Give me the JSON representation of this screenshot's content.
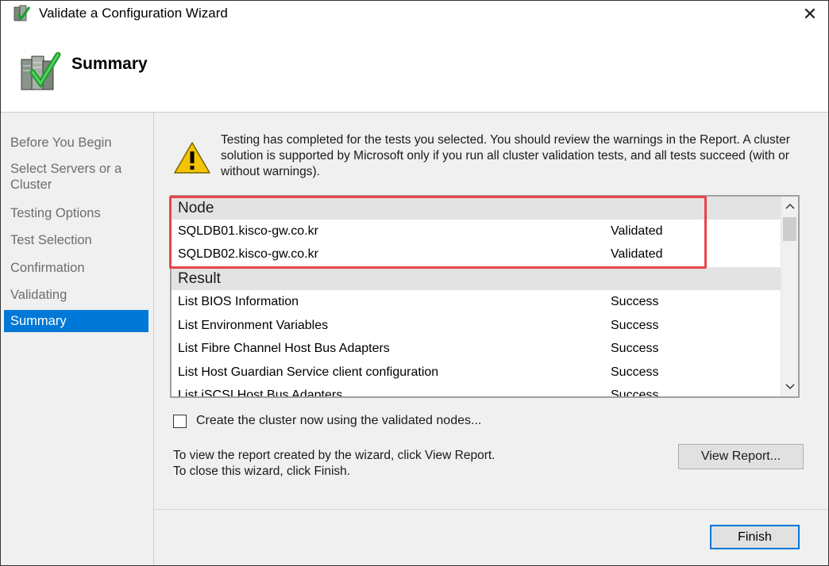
{
  "window": {
    "title": "Validate a Configuration Wizard",
    "close_glyph": "✕"
  },
  "header": {
    "title": "Summary"
  },
  "nav": {
    "items": [
      {
        "label": "Before You Begin"
      },
      {
        "label": "Select Servers or a"
      },
      {
        "label": "Cluster"
      },
      {
        "label": "Testing Options"
      },
      {
        "label": "Test Selection"
      },
      {
        "label": "Confirmation"
      },
      {
        "label": "Validating"
      },
      {
        "label": "Summary",
        "active": true
      }
    ]
  },
  "main": {
    "intro": "Testing has completed for the tests you selected. You should review the warnings in the Report.  A cluster solution is supported by Microsoft only if you run all cluster validation tests, and all tests succeed (with or without warnings).",
    "list": {
      "node_group": "Node",
      "nodes": [
        {
          "name": "SQLDB01.kisco-gw.co.kr",
          "status": "Validated"
        },
        {
          "name": "SQLDB02.kisco-gw.co.kr",
          "status": "Validated"
        }
      ],
      "result_group": "Result",
      "results": [
        {
          "name": "List BIOS Information",
          "status": "Success"
        },
        {
          "name": "List Environment Variables",
          "status": "Success"
        },
        {
          "name": "List Fibre Channel Host Bus Adapters",
          "status": "Success"
        },
        {
          "name": "List Host Guardian Service client configuration",
          "status": "Success"
        },
        {
          "name": "List iSCSI Host Bus Adapters",
          "status": "Success"
        }
      ]
    },
    "checkbox_label": "Create the cluster now using the validated nodes...",
    "checkbox_checked": false,
    "info_line1": "To view the report created by the wizard, click View Report.",
    "info_line2": "To close this wizard, click Finish.",
    "view_report_label": "View Report..."
  },
  "footer": {
    "finish_label": "Finish"
  },
  "colors": {
    "accent": "#0078d7",
    "highlight": "#e8454a",
    "panel": "#f0f0f0"
  }
}
